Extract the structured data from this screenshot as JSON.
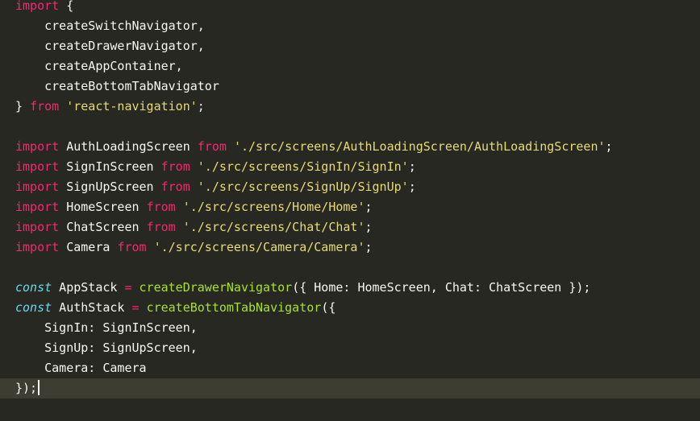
{
  "editor": {
    "lines": [
      {
        "indent": "",
        "tokens": [
          {
            "t": "kw",
            "v": "import"
          },
          {
            "t": "pl",
            "v": " {"
          }
        ]
      },
      {
        "indent": "    ",
        "tokens": [
          {
            "t": "pl",
            "v": "createSwitchNavigator,"
          }
        ]
      },
      {
        "indent": "    ",
        "tokens": [
          {
            "t": "pl",
            "v": "createDrawerNavigator,"
          }
        ]
      },
      {
        "indent": "    ",
        "tokens": [
          {
            "t": "pl",
            "v": "createAppContainer,"
          }
        ]
      },
      {
        "indent": "    ",
        "tokens": [
          {
            "t": "pl",
            "v": "createBottomTabNavigator"
          }
        ]
      },
      {
        "indent": "",
        "tokens": [
          {
            "t": "pl",
            "v": "} "
          },
          {
            "t": "kw",
            "v": "from"
          },
          {
            "t": "pl",
            "v": " "
          },
          {
            "t": "str",
            "v": "'react-navigation'"
          },
          {
            "t": "pl",
            "v": ";"
          }
        ]
      },
      {
        "indent": "",
        "tokens": []
      },
      {
        "indent": "",
        "tokens": [
          {
            "t": "kw",
            "v": "import"
          },
          {
            "t": "pl",
            "v": " AuthLoadingScreen "
          },
          {
            "t": "kw",
            "v": "from"
          },
          {
            "t": "pl",
            "v": " "
          },
          {
            "t": "str",
            "v": "'./src/screens/AuthLoadingScreen/AuthLoadingScreen'"
          },
          {
            "t": "pl",
            "v": ";"
          }
        ]
      },
      {
        "indent": "",
        "tokens": [
          {
            "t": "kw",
            "v": "import"
          },
          {
            "t": "pl",
            "v": " SignInScreen "
          },
          {
            "t": "kw",
            "v": "from"
          },
          {
            "t": "pl",
            "v": " "
          },
          {
            "t": "str",
            "v": "'./src/screens/SignIn/SignIn'"
          },
          {
            "t": "pl",
            "v": ";"
          }
        ]
      },
      {
        "indent": "",
        "tokens": [
          {
            "t": "kw",
            "v": "import"
          },
          {
            "t": "pl",
            "v": " SignUpScreen "
          },
          {
            "t": "kw",
            "v": "from"
          },
          {
            "t": "pl",
            "v": " "
          },
          {
            "t": "str",
            "v": "'./src/screens/SignUp/SignUp'"
          },
          {
            "t": "pl",
            "v": ";"
          }
        ]
      },
      {
        "indent": "",
        "tokens": [
          {
            "t": "kw",
            "v": "import"
          },
          {
            "t": "pl",
            "v": " HomeScreen "
          },
          {
            "t": "kw",
            "v": "from"
          },
          {
            "t": "pl",
            "v": " "
          },
          {
            "t": "str",
            "v": "'./src/screens/Home/Home'"
          },
          {
            "t": "pl",
            "v": ";"
          }
        ]
      },
      {
        "indent": "",
        "tokens": [
          {
            "t": "kw",
            "v": "import"
          },
          {
            "t": "pl",
            "v": " ChatScreen "
          },
          {
            "t": "kw",
            "v": "from"
          },
          {
            "t": "pl",
            "v": " "
          },
          {
            "t": "str",
            "v": "'./src/screens/Chat/Chat'"
          },
          {
            "t": "pl",
            "v": ";"
          }
        ]
      },
      {
        "indent": "",
        "tokens": [
          {
            "t": "kw",
            "v": "import"
          },
          {
            "t": "pl",
            "v": " Camera "
          },
          {
            "t": "kw",
            "v": "from"
          },
          {
            "t": "pl",
            "v": " "
          },
          {
            "t": "str",
            "v": "'./src/screens/Camera/Camera'"
          },
          {
            "t": "pl",
            "v": ";"
          }
        ]
      },
      {
        "indent": "",
        "tokens": []
      },
      {
        "indent": "",
        "tokens": [
          {
            "t": "ty",
            "v": "const"
          },
          {
            "t": "pl",
            "v": " AppStack "
          },
          {
            "t": "kw",
            "v": "="
          },
          {
            "t": "pl",
            "v": " "
          },
          {
            "t": "fn",
            "v": "createDrawerNavigator"
          },
          {
            "t": "pl",
            "v": "({ Home: HomeScreen, Chat: ChatScreen });"
          }
        ]
      },
      {
        "indent": "",
        "tokens": [
          {
            "t": "ty",
            "v": "const"
          },
          {
            "t": "pl",
            "v": " AuthStack "
          },
          {
            "t": "kw",
            "v": "="
          },
          {
            "t": "pl",
            "v": " "
          },
          {
            "t": "fn",
            "v": "createBottomTabNavigator"
          },
          {
            "t": "pl",
            "v": "({"
          }
        ]
      },
      {
        "indent": "    ",
        "tokens": [
          {
            "t": "pl",
            "v": "SignIn: SignInScreen,"
          }
        ]
      },
      {
        "indent": "    ",
        "tokens": [
          {
            "t": "pl",
            "v": "SignUp: SignUpScreen,"
          }
        ]
      },
      {
        "indent": "    ",
        "tokens": [
          {
            "t": "pl",
            "v": "Camera: Camera"
          }
        ]
      },
      {
        "indent": "",
        "tokens": [
          {
            "t": "pl",
            "v": "});"
          }
        ]
      }
    ],
    "current_line": 20,
    "colors": {
      "background": "#272822",
      "current_line": "#3e3d32",
      "keyword": "#f92672",
      "storage_type": "#66d9ef",
      "function": "#a6e22e",
      "string": "#e6db74",
      "plain": "#f8f8f2"
    }
  }
}
